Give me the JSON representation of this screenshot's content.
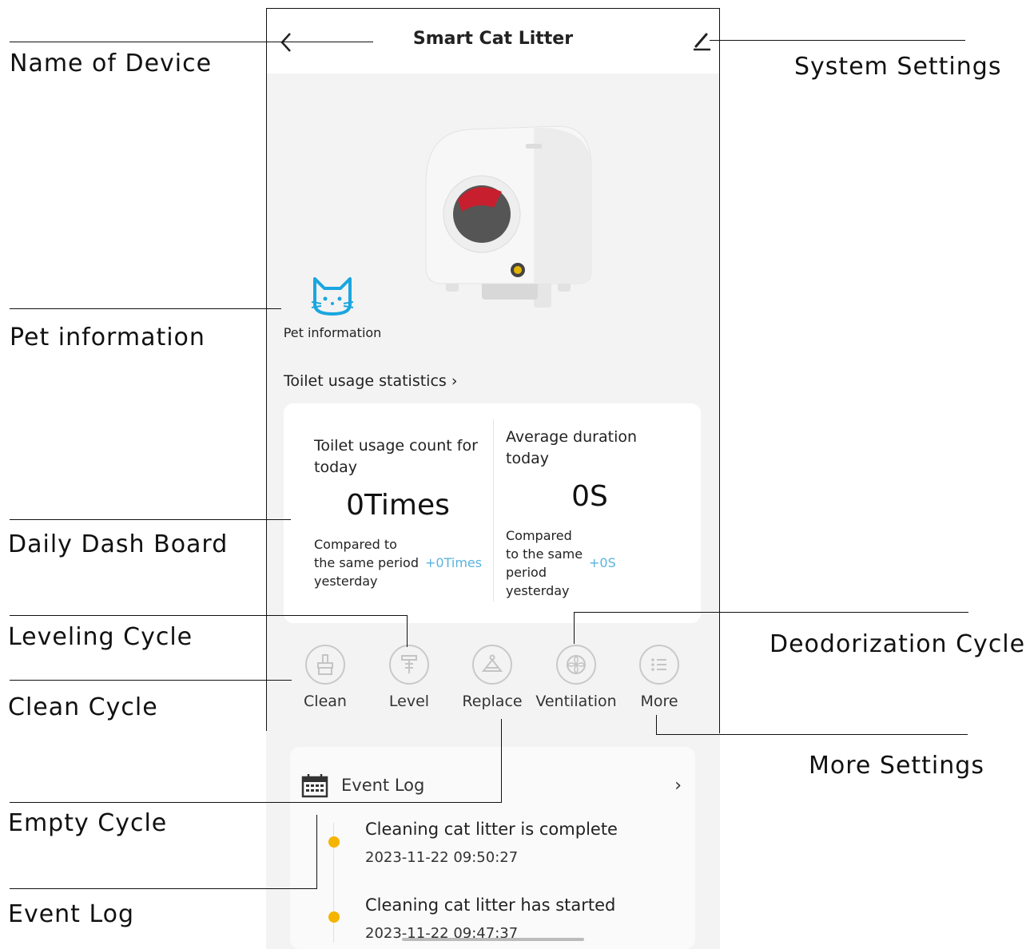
{
  "header": {
    "title": "Smart Cat Litter"
  },
  "pet": {
    "label": "Pet information"
  },
  "stats": {
    "link_label": "Toilet usage statistics",
    "count": {
      "title_line1": "Toilet usage count for",
      "title_line2": "today",
      "value": "0Times",
      "compare_line1": "Compared to",
      "compare_line2": "the same period",
      "compare_line3": "yesterday",
      "delta": "+0Times"
    },
    "duration": {
      "title_line1": "Average duration",
      "title_line2": "today",
      "value": "0S",
      "compare_line1": "Compared",
      "compare_line2": "to the same",
      "compare_line3": "period",
      "compare_line4": "yesterday",
      "delta": "+0S"
    }
  },
  "actions": [
    {
      "label": "Clean",
      "icon": "broom-icon"
    },
    {
      "label": "Level",
      "icon": "level-icon"
    },
    {
      "label": "Replace",
      "icon": "replace-icon"
    },
    {
      "label": "Ventilation",
      "icon": "fan-icon"
    },
    {
      "label": "More",
      "icon": "list-icon"
    }
  ],
  "event_log": {
    "title": "Event Log",
    "events": [
      {
        "title": "Cleaning cat litter is complete",
        "time": "2023-11-22 09:50:27"
      },
      {
        "title": "Cleaning cat litter has started",
        "time": "2023-11-22 09:47:37"
      }
    ]
  },
  "annotations": {
    "name_of_device": "Name  of  Device",
    "system_settings": "System Settings",
    "pet_information": "Pet information",
    "daily_dash_board": "Daily Dash Board",
    "leveling_cycle": "Leveling Cycle",
    "clean_cycle": "Clean Cycle",
    "deodorization_cycle": "Deodorization Cycle",
    "more_settings": "More Settings",
    "empty_cycle": "Empty Cycle",
    "event_log": "Event Log"
  },
  "colors": {
    "accent_blue": "#1aa6e0",
    "delta_blue": "#5ab3dd",
    "dot_yellow": "#f5b400"
  }
}
